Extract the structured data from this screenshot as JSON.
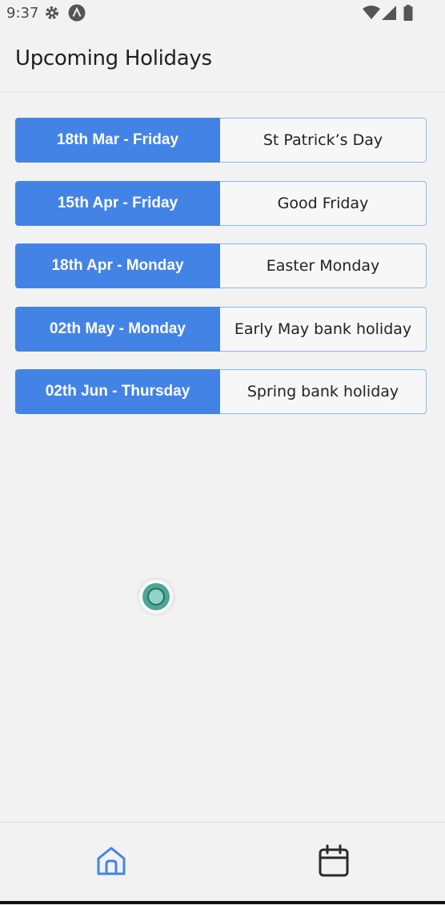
{
  "status_bar": {
    "time": "9:37",
    "icons": [
      "settings-gear-icon",
      "app-a-icon",
      "wifi-icon",
      "signal-icon",
      "battery-icon"
    ]
  },
  "header": {
    "title": "Upcoming Holidays"
  },
  "holidays": [
    {
      "date": "18th Mar - Friday",
      "name": "St Patrick’s Day"
    },
    {
      "date": "15th Apr - Friday",
      "name": "Good Friday"
    },
    {
      "date": "18th Apr - Monday",
      "name": "Easter Monday"
    },
    {
      "date": "02th May - Monday",
      "name": "Early May bank holiday"
    },
    {
      "date": "02th Jun - Thursday",
      "name": "Spring bank holiday"
    }
  ],
  "bottom_nav": {
    "tabs": [
      {
        "icon": "home-icon",
        "active": true
      },
      {
        "icon": "calendar-icon",
        "active": false
      }
    ]
  },
  "colors": {
    "accent": "#4483e6",
    "background": "#f2f2f2",
    "border": "#8fb4ee",
    "touch_indicator": "#4aa796"
  }
}
